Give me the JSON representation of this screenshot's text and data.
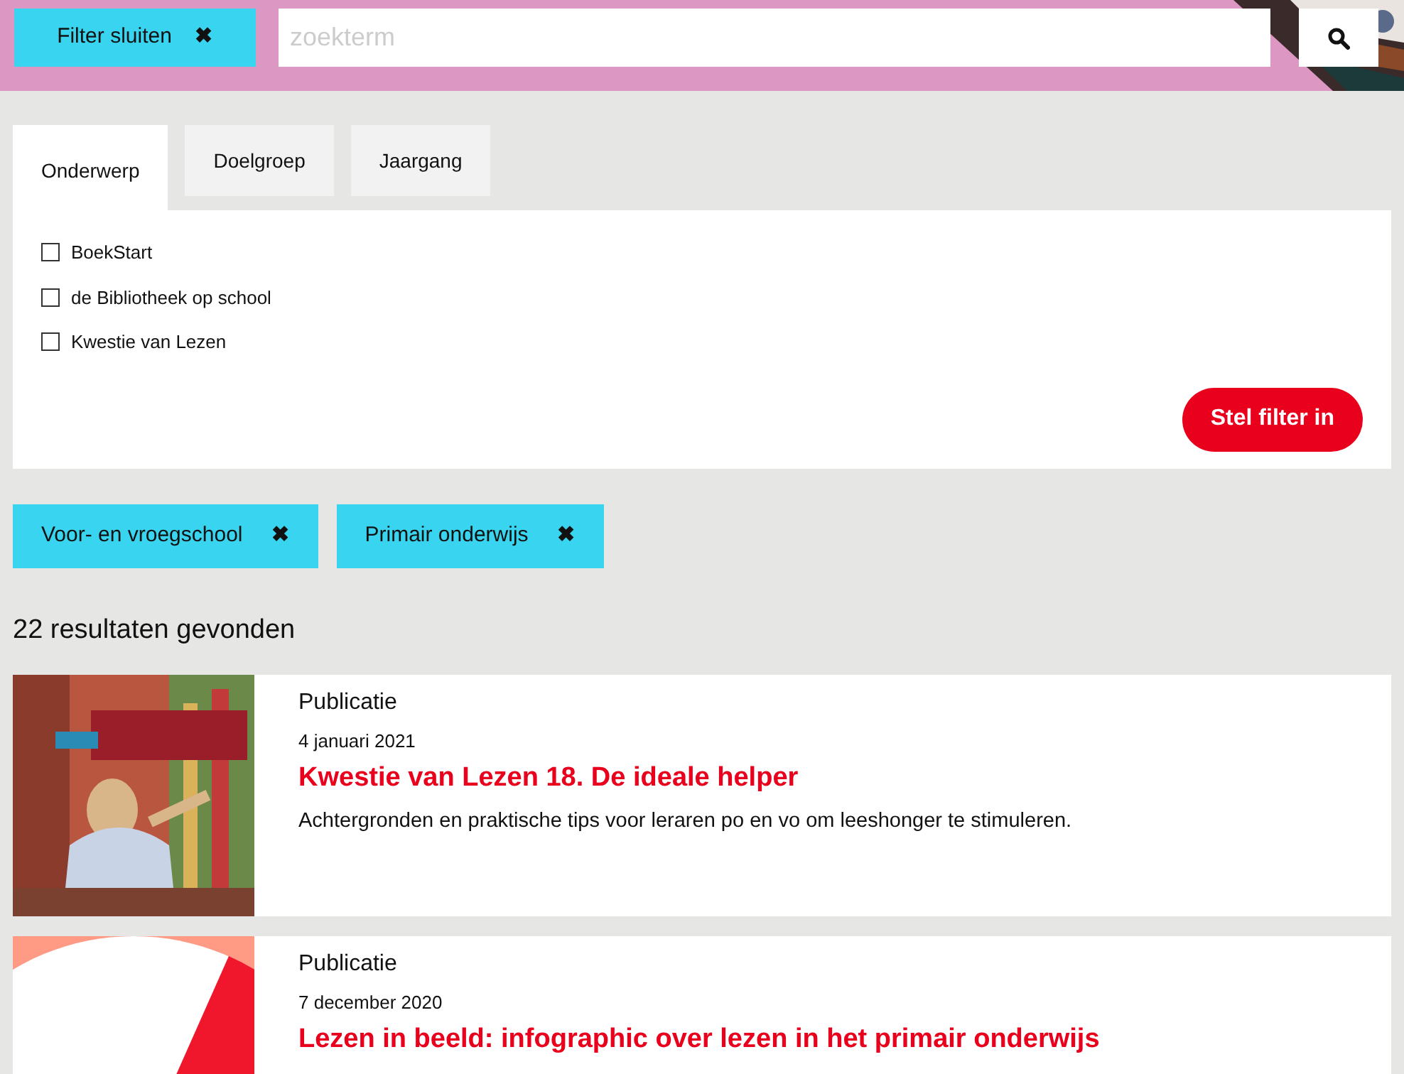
{
  "header": {
    "close_filter": "Filter sluiten",
    "close_icon": "✖",
    "search": {
      "placeholder": "zoekterm"
    }
  },
  "filter": {
    "tabs": [
      {
        "label": "Onderwerp",
        "selected": true
      },
      {
        "label": "Doelgroep",
        "selected": false
      },
      {
        "label": "Jaargang",
        "selected": false
      }
    ],
    "options": [
      {
        "label": "BoekStart",
        "checked": false
      },
      {
        "label": "de Bibliotheek op school",
        "checked": false
      },
      {
        "label": "Kwestie van Lezen",
        "checked": false
      }
    ],
    "apply_button": "Stel filter in"
  },
  "active_filters": [
    {
      "label": "Voor- en vroegschool",
      "remove_icon": "✖"
    },
    {
      "label": "Primair onderwijs",
      "remove_icon": "✖"
    }
  ],
  "result_count": "22 resultaten gevonden",
  "results": [
    {
      "type": "Publicatie",
      "date": "4 januari 2021",
      "title": "Kwestie van Lezen 18. De ideale helper",
      "summary": "Achtergronden en praktische tips voor leraren po en vo om leeshonger te stimuleren."
    },
    {
      "image": {
        "kind": "graphic"
      },
      "type": "Publicatie",
      "date": "7 december 2020",
      "title": "Lezen in beeld: infographic over lezen in het primair onderwijs"
    }
  ]
}
